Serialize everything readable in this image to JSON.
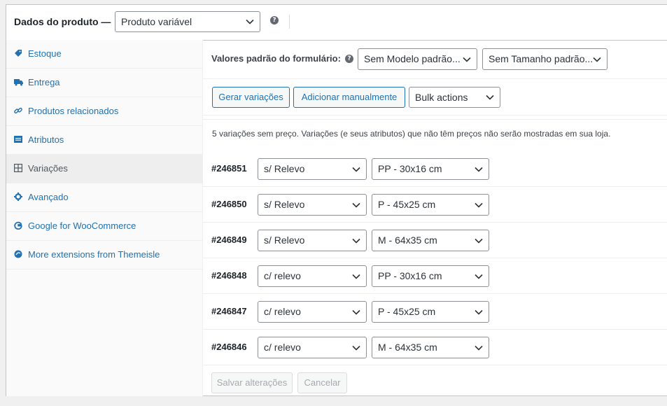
{
  "header": {
    "title": "Dados do produto —",
    "product_type": "Produto variável",
    "help_glyph": "?"
  },
  "sidebar": {
    "items": [
      {
        "label": "Estoque",
        "icon": "tag-icon"
      },
      {
        "label": "Entrega",
        "icon": "truck-icon"
      },
      {
        "label": "Produtos relacionados",
        "icon": "link-icon"
      },
      {
        "label": "Atributos",
        "icon": "list-icon"
      },
      {
        "label": "Variações",
        "icon": "grid-icon",
        "active": true
      },
      {
        "label": "Avançado",
        "icon": "gear-icon"
      },
      {
        "label": "Google for WooCommerce",
        "icon": "google-icon"
      },
      {
        "label": "More extensions from Themeisle",
        "icon": "themeisle-icon"
      }
    ]
  },
  "defaults": {
    "label": "Valores padrão do formulário:",
    "model_select": "Sem Modelo padrão...",
    "size_select": "Sem Tamanho padrão..."
  },
  "actions": {
    "generate": "Gerar variações",
    "add_manual": "Adicionar manualmente",
    "bulk": "Bulk actions"
  },
  "notice": "5 variações sem preço. Variações (e seus atributos) que não têm preços não serão mostradas em sua loja.",
  "variations": [
    {
      "id": "#246851",
      "model": "s/ Relevo",
      "size": "PP - 30x16 cm"
    },
    {
      "id": "#246850",
      "model": "s/ Relevo",
      "size": "P - 45x25 cm"
    },
    {
      "id": "#246849",
      "model": "s/ Relevo",
      "size": "M - 64x35 cm"
    },
    {
      "id": "#246848",
      "model": "c/ relevo",
      "size": "PP - 30x16 cm"
    },
    {
      "id": "#246847",
      "model": "c/ relevo",
      "size": "P - 45x25 cm"
    },
    {
      "id": "#246846",
      "model": "c/ relevo",
      "size": "M - 64x35 cm"
    }
  ],
  "footer": {
    "save": "Salvar alterações",
    "cancel": "Cancelar"
  },
  "colors": {
    "link": "#2271b1",
    "border": "#c3c4c7",
    "background": "#f0f0f1"
  }
}
